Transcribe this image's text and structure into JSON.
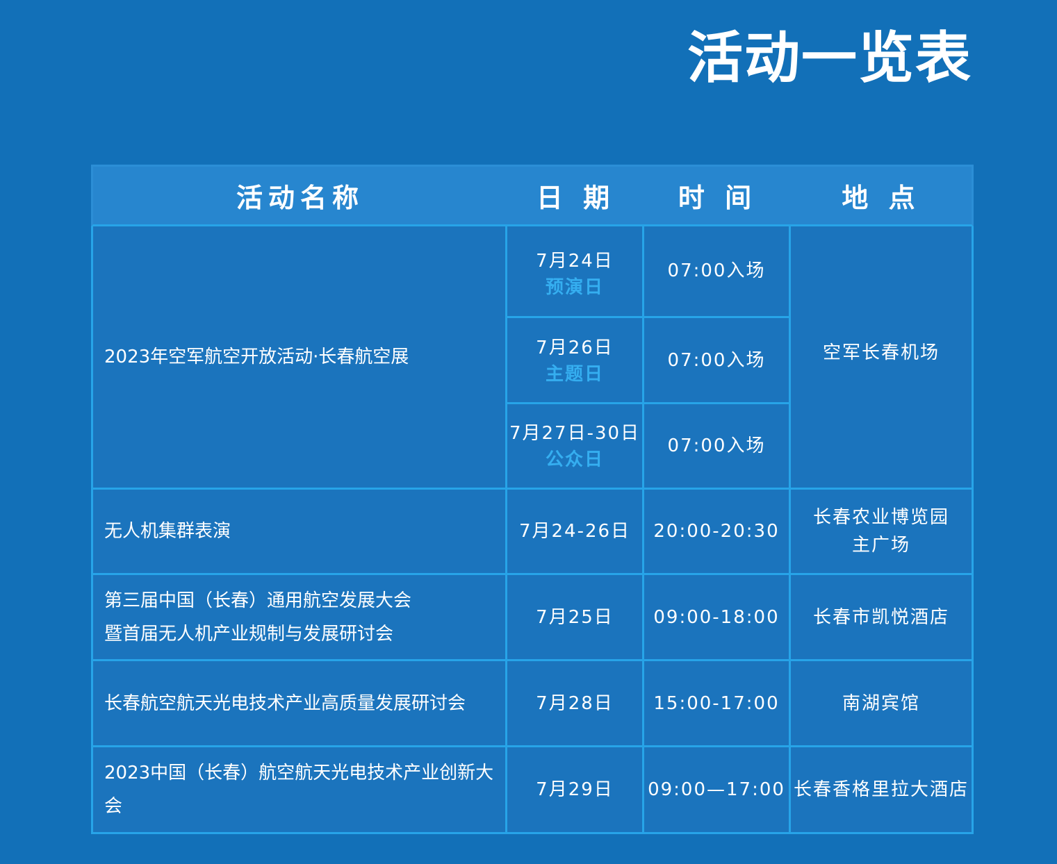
{
  "title": "活动一览表",
  "table": {
    "headers": [
      "活动名称",
      "日 期",
      "时 间",
      "地 点"
    ],
    "airshow": {
      "name": "2023年空军航空开放活动·长春航空展",
      "location": "空军长春机场",
      "sessions": [
        {
          "date": "7月24日",
          "label": "预演日",
          "time": "07:00入场"
        },
        {
          "date": "7月26日",
          "label": "主题日",
          "time": "07:00入场"
        },
        {
          "date": "7月27日-30日",
          "label": "公众日",
          "time": "07:00入场"
        }
      ]
    },
    "rows": [
      {
        "name_lines": [
          "无人机集群表演"
        ],
        "date": "7月24-26日",
        "time": "20:00-20:30",
        "location_lines": [
          "长春农业博览园",
          "主广场"
        ]
      },
      {
        "name_lines": [
          "第三届中国（长春）通用航空发展大会",
          "暨首届无人机产业规制与发展研讨会"
        ],
        "date": "7月25日",
        "time": "09:00-18:00",
        "location_lines": [
          "长春市凯悦酒店"
        ]
      },
      {
        "name_lines": [
          "长春航空航天光电技术产业高质量发展研讨会"
        ],
        "date": "7月28日",
        "time": "15:00-17:00",
        "location_lines": [
          "南湖宾馆"
        ]
      },
      {
        "name_lines": [
          "2023中国（长春）航空航天光电技术产业创新大会"
        ],
        "date": "7月29日",
        "time": "09:00—17:00",
        "location_lines": [
          "长春香格里拉大酒店"
        ]
      }
    ]
  }
}
